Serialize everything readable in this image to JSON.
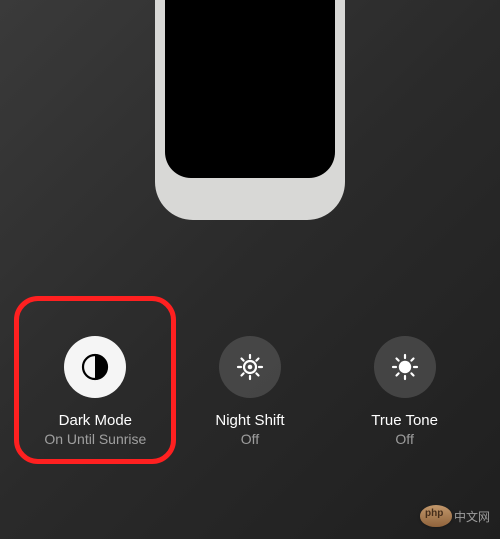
{
  "controls": [
    {
      "title": "Dark Mode",
      "status": "On Until Sunrise",
      "active": true
    },
    {
      "title": "Night Shift",
      "status": "Off",
      "active": false
    },
    {
      "title": "True Tone",
      "status": "Off",
      "active": false
    }
  ],
  "watermark": {
    "text": "中文网"
  }
}
